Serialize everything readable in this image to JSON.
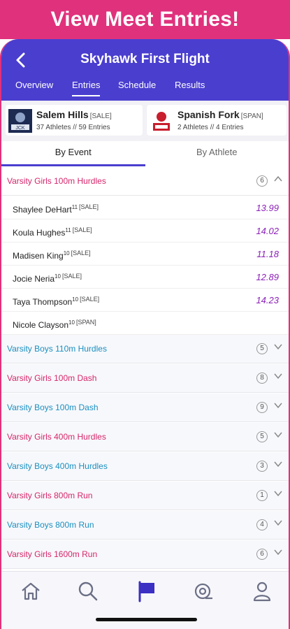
{
  "promo": {
    "text": "View Meet Entries!"
  },
  "header": {
    "title": "Skyhawk First Flight",
    "tabs": [
      "Overview",
      "Entries",
      "Schedule",
      "Results"
    ],
    "active_tab": "Entries"
  },
  "teams": [
    {
      "name": "Salem Hills",
      "abbr": "[SALE]",
      "stats": "37 Athletes // 59 Entries"
    },
    {
      "name": "Spanish Fork",
      "abbr": "[SPAN]",
      "stats": "2 Athletes // 4 Entries"
    }
  ],
  "subtabs": {
    "by_event": "By Event",
    "by_athlete": "By Athlete",
    "active": "By Event"
  },
  "expanded_event": {
    "name": "Varsity Girls 100m Hurdles",
    "count": "6",
    "athletes": [
      {
        "name": "Shaylee DeHart",
        "grade": "11",
        "team": "[SALE]",
        "mark": "13.99"
      },
      {
        "name": "Koula Hughes",
        "grade": "11",
        "team": "[SALE]",
        "mark": "14.02"
      },
      {
        "name": "Madisen King",
        "grade": "10",
        "team": "[SALE]",
        "mark": "11.18"
      },
      {
        "name": "Jocie Neria",
        "grade": "10",
        "team": "[SALE]",
        "mark": "12.89"
      },
      {
        "name": "Taya Thompson",
        "grade": "10",
        "team": "[SALE]",
        "mark": "14.23"
      },
      {
        "name": "Nicole Clayson",
        "grade": "10",
        "team": "[SPAN]",
        "mark": ""
      }
    ]
  },
  "events": [
    {
      "name": "Varsity Boys 110m Hurdles",
      "count": "5",
      "gender": "boys"
    },
    {
      "name": "Varsity Girls 100m Dash",
      "count": "8",
      "gender": "girls"
    },
    {
      "name": "Varsity Boys 100m Dash",
      "count": "9",
      "gender": "boys"
    },
    {
      "name": "Varsity Girls 400m Hurdles",
      "count": "5",
      "gender": "girls"
    },
    {
      "name": "Varsity Boys 400m Hurdles",
      "count": "3",
      "gender": "boys"
    },
    {
      "name": "Varsity Girls 800m Run",
      "count": "1",
      "gender": "girls"
    },
    {
      "name": "Varsity Boys 800m Run",
      "count": "4",
      "gender": "boys"
    },
    {
      "name": "Varsity Girls 1600m Run",
      "count": "6",
      "gender": "girls"
    }
  ],
  "nav": [
    "home-icon",
    "search-icon",
    "flag-icon",
    "target-icon",
    "profile-icon"
  ],
  "colors": {
    "header": "#4a3ecf",
    "promo": "#e0317c",
    "girls": "#d6256b",
    "boys": "#1a8fc0",
    "mark": "#8b1fb8"
  }
}
